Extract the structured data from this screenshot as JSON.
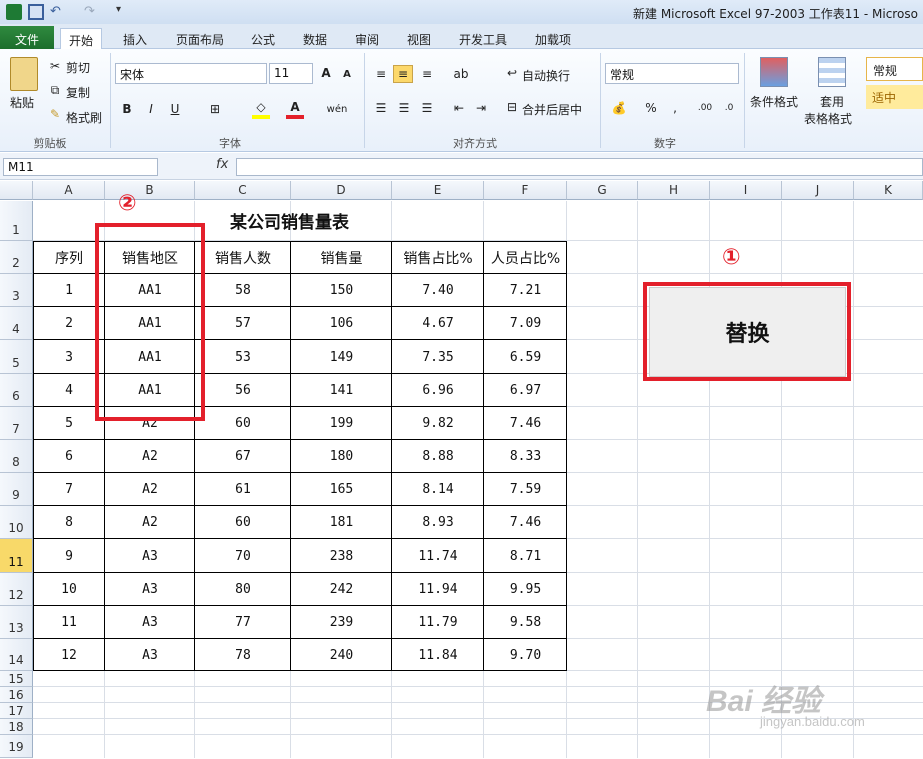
{
  "window": {
    "title": "新建 Microsoft Excel 97-2003 工作表11 - Microso"
  },
  "tabs": [
    {
      "label": "文件"
    },
    {
      "label": "开始"
    },
    {
      "label": "插入"
    },
    {
      "label": "页面布局"
    },
    {
      "label": "公式"
    },
    {
      "label": "数据"
    },
    {
      "label": "审阅"
    },
    {
      "label": "视图"
    },
    {
      "label": "开发工具"
    },
    {
      "label": "加载项"
    }
  ],
  "ribbon": {
    "clipboard": {
      "paste": "粘贴",
      "cut": "剪切",
      "copy": "复制",
      "format_painter": "格式刷",
      "group": "剪贴板"
    },
    "font": {
      "name": "宋体",
      "size": "11",
      "group": "字体"
    },
    "alignment": {
      "wrap": "自动换行",
      "merge": "合并后居中",
      "group": "对齐方式"
    },
    "number": {
      "format": "常规",
      "group": "数字"
    },
    "styles": {
      "conditional": "条件格式",
      "table_line1": "套用",
      "table_line2": "表格格式",
      "style_normal": "常规",
      "style_neutral": "适中"
    }
  },
  "formula_bar": {
    "name_box": "M11",
    "fx": "fx",
    "value": ""
  },
  "columns": [
    "A",
    "B",
    "C",
    "D",
    "E",
    "F",
    "G",
    "H",
    "I",
    "J",
    "K"
  ],
  "rows": [
    "1",
    "2",
    "3",
    "4",
    "5",
    "6",
    "7",
    "8",
    "9",
    "10",
    "11",
    "12",
    "13",
    "14",
    "15",
    "16",
    "17",
    "18",
    "19"
  ],
  "sheet": {
    "title": "某公司销售量表",
    "headers": [
      "序列",
      "销售地区",
      "销售人数",
      "销售量",
      "销售占比%",
      "人员占比%"
    ],
    "data": [
      [
        "1",
        "AA1",
        "58",
        "150",
        "7.40",
        "7.21"
      ],
      [
        "2",
        "AA1",
        "57",
        "106",
        "4.67",
        "7.09"
      ],
      [
        "3",
        "AA1",
        "53",
        "149",
        "7.35",
        "6.59"
      ],
      [
        "4",
        "AA1",
        "56",
        "141",
        "6.96",
        "6.97"
      ],
      [
        "5",
        "A2",
        "60",
        "199",
        "9.82",
        "7.46"
      ],
      [
        "6",
        "A2",
        "67",
        "180",
        "8.88",
        "8.33"
      ],
      [
        "7",
        "A2",
        "61",
        "165",
        "8.14",
        "7.59"
      ],
      [
        "8",
        "A2",
        "60",
        "181",
        "8.93",
        "7.46"
      ],
      [
        "9",
        "A3",
        "70",
        "238",
        "11.74",
        "8.71"
      ],
      [
        "10",
        "A3",
        "80",
        "242",
        "11.94",
        "9.95"
      ],
      [
        "11",
        "A3",
        "77",
        "239",
        "11.79",
        "9.58"
      ],
      [
        "12",
        "A3",
        "78",
        "240",
        "11.84",
        "9.70"
      ]
    ]
  },
  "annotations": {
    "marker1": "①",
    "marker2": "②",
    "button_label": "替换",
    "color": "#e3202b"
  },
  "watermark": {
    "brand": "Bai 经验",
    "url": "jingyan.baidu.com"
  }
}
